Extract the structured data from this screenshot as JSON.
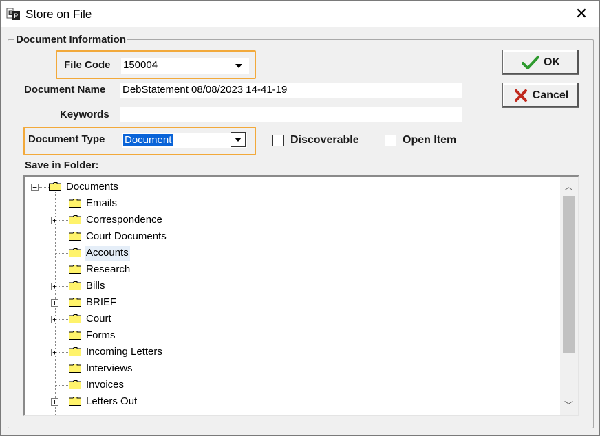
{
  "window": {
    "title": "Store on File",
    "close_glyph": "✕"
  },
  "group": {
    "legend": "Document Information"
  },
  "fields": {
    "file_code_label": "File Code",
    "file_code_value": "150004",
    "document_name_label": "Document Name",
    "document_name_value": "DebStatement 08/08/2023 14-41-19",
    "keywords_label": "Keywords",
    "keywords_value": "",
    "document_type_label": "Document Type",
    "document_type_value": "Document",
    "discoverable_label": "Discoverable",
    "discoverable_checked": false,
    "open_item_label": "Open Item",
    "open_item_checked": false,
    "save_in_folder_label": "Save in Folder:"
  },
  "buttons": {
    "ok_label": "OK",
    "cancel_label": "Cancel"
  },
  "tree": {
    "root": {
      "label": "Documents",
      "expander": "−"
    },
    "items": [
      {
        "label": "Emails",
        "expander": ""
      },
      {
        "label": "Correspondence",
        "expander": "+"
      },
      {
        "label": "Court Documents",
        "expander": ""
      },
      {
        "label": "Accounts",
        "expander": "",
        "selected": true
      },
      {
        "label": "Research",
        "expander": ""
      },
      {
        "label": "Bills",
        "expander": "+"
      },
      {
        "label": "BRIEF",
        "expander": "+"
      },
      {
        "label": "Court",
        "expander": "+"
      },
      {
        "label": "Forms",
        "expander": ""
      },
      {
        "label": "Incoming Letters",
        "expander": "+"
      },
      {
        "label": "Interviews",
        "expander": ""
      },
      {
        "label": "Invoices",
        "expander": ""
      },
      {
        "label": "Letters Out",
        "expander": "+"
      }
    ]
  },
  "colors": {
    "highlight_border": "#f2a93b",
    "selection_blue": "#0a64d8",
    "ok_check": "#2e9a2e",
    "cancel_x": "#c0281c",
    "folder_fill": "#fff36b"
  }
}
